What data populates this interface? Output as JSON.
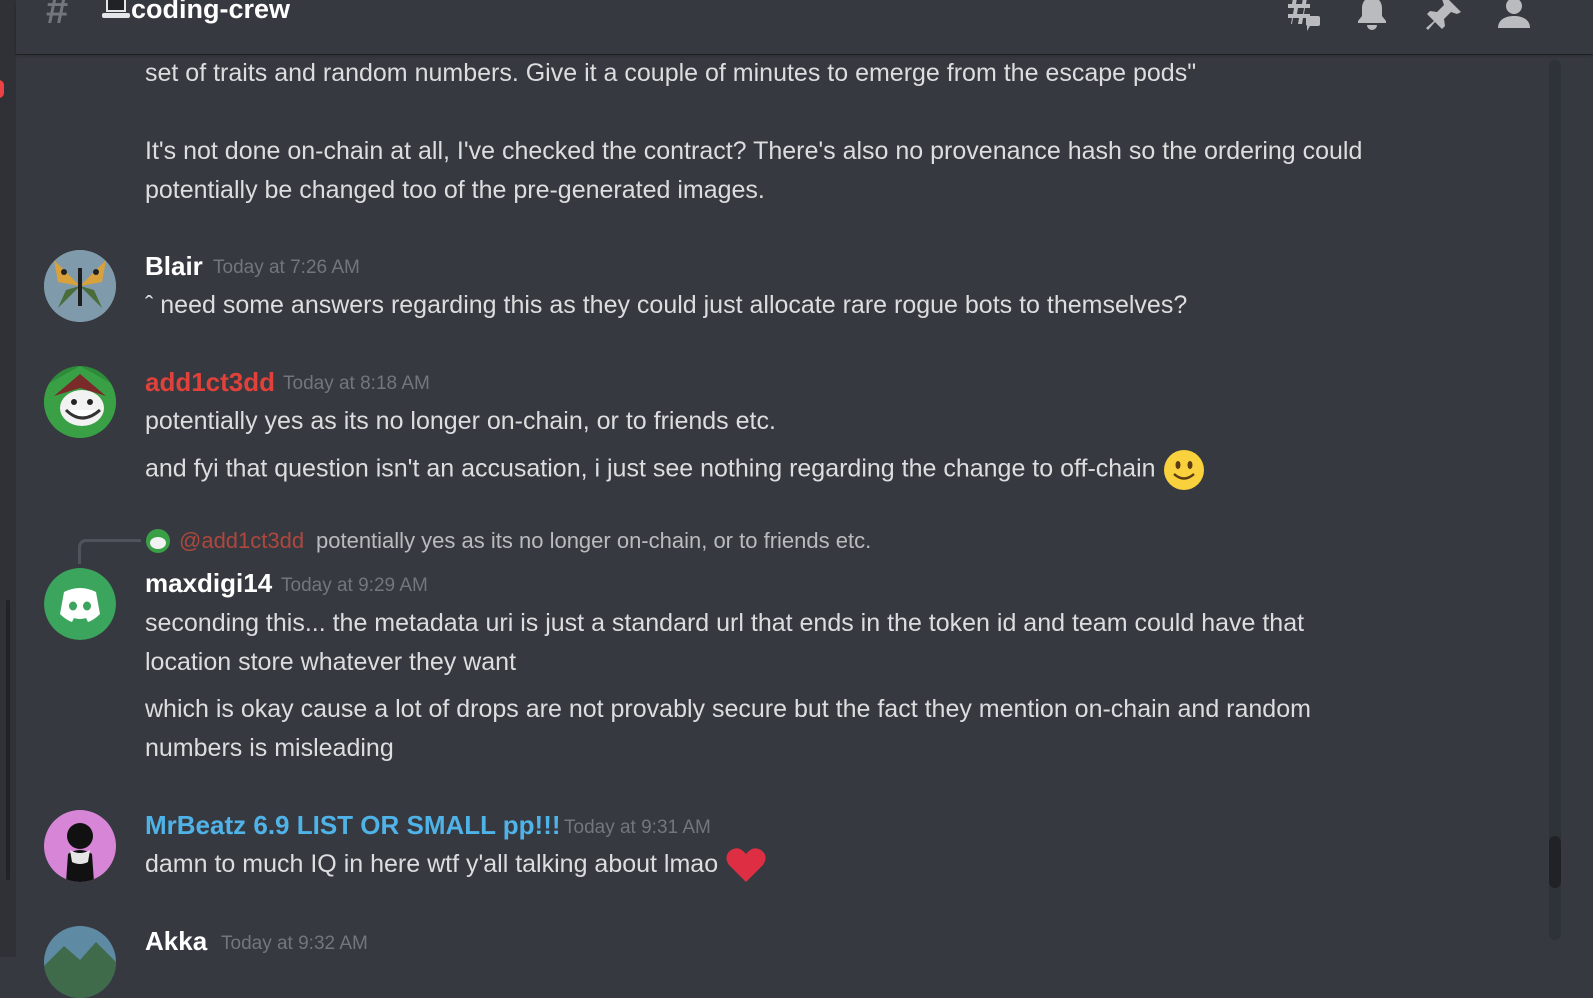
{
  "channel": {
    "hash_symbol": "#",
    "name": "coding-crew",
    "header_icons": [
      "threads-icon",
      "bell-icon",
      "pin-icon",
      "member-list-icon"
    ]
  },
  "colors": {
    "background": "#36393f",
    "header": "#36393f",
    "addict_name": "#e0413a",
    "mrbeatz_name": "#4fb3e8",
    "default_name": "#ffffff",
    "timestamp": "#72767d"
  },
  "messages": {
    "prev": {
      "line1": "set of traits and random numbers. Give it a couple of minutes to emerge from the escape pods\"",
      "line2": "It's not done on-chain at all, I've checked the contract? There's also no provenance hash so the ordering could",
      "line3": "potentially be changed too of the pre-generated images."
    },
    "blair": {
      "author": "Blair",
      "timestamp": "Today at 7:26 AM",
      "text": "ˆ need some answers regarding this as they could just allocate rare rogue bots to themselves?"
    },
    "addict": {
      "author": "add1ct3dd",
      "timestamp": "Today at 8:18 AM",
      "text1": "potentially yes as its no longer on-chain, or to friends etc.",
      "text2": "and fyi that question isn't an accusation, i just see nothing regarding the change to off-chain"
    },
    "maxdigi": {
      "reply_mention": "@add1ct3dd",
      "reply_text": "potentially yes as its no longer on-chain, or to friends etc.",
      "author": "maxdigi14",
      "timestamp": "Today at 9:29 AM",
      "line1": "seconding this... the metadata uri is just a standard url that ends in the token id and team could have that",
      "line2": "location store whatever they want",
      "line3": "which is okay cause a lot of drops are not provably secure but the fact they mention on-chain and random",
      "line4": "numbers is misleading"
    },
    "mrbeatz": {
      "author": "MrBeatz 6.9 LIST OR SMALL pp!!!",
      "timestamp": "Today at 9:31 AM",
      "text": "damn to much IQ in here wtf y'all talking about lmao"
    },
    "akka": {
      "author": "Akka",
      "timestamp": "Today at 9:32 AM"
    }
  }
}
